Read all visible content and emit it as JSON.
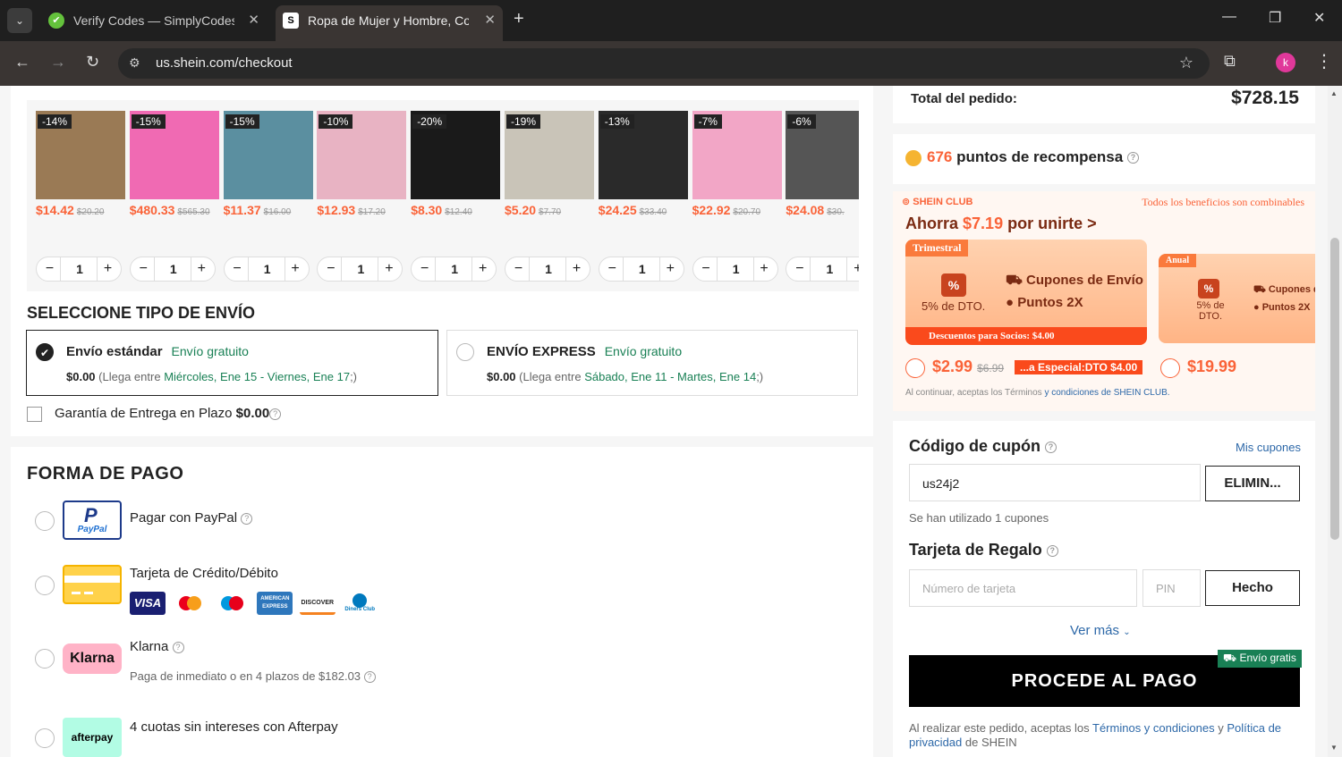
{
  "browser": {
    "tabs": [
      {
        "title": "Verify Codes — SimplyCodes",
        "favicon": "✔"
      },
      {
        "title": "Ropa de Mujer y Hombre, Comp",
        "favicon": "S"
      }
    ],
    "url": "us.shein.com/checkout",
    "profile_initial": "k"
  },
  "products": [
    {
      "discount": "-14%",
      "price": "$14.42",
      "old_price": "$20.20",
      "qty": "1",
      "color": "#9a7a55"
    },
    {
      "discount": "-15%",
      "price": "$480.33",
      "old_price": "$565.30",
      "qty": "1",
      "color": "#f06ab3"
    },
    {
      "discount": "-15%",
      "price": "$11.37",
      "old_price": "$16.00",
      "qty": "1",
      "color": "#5b8fa0"
    },
    {
      "discount": "-10%",
      "price": "$12.93",
      "old_price": "$17.20",
      "qty": "1",
      "color": "#e8b3c3"
    },
    {
      "discount": "-20%",
      "price": "$8.30",
      "old_price": "$12.40",
      "qty": "1",
      "color": "#1a1a1a"
    },
    {
      "discount": "-19%",
      "price": "$5.20",
      "old_price": "$7.70",
      "qty": "1",
      "color": "#c9c4b8"
    },
    {
      "discount": "-13%",
      "price": "$24.25",
      "old_price": "$33.40",
      "qty": "1",
      "color": "#2a2a2a"
    },
    {
      "discount": "-7%",
      "price": "$22.92",
      "old_price": "$20.70",
      "qty": "1",
      "color": "#f2a6c6"
    },
    {
      "discount": "-6%",
      "price": "$24.08",
      "old_price": "$30.",
      "qty": "1",
      "color": "#555555"
    }
  ],
  "shipping": {
    "title": "SELECCIONE TIPO DE ENVÍO",
    "options": [
      {
        "name": "Envío estándar",
        "free": "Envío gratuito",
        "cost": "$0.00",
        "detail_prefix": "(Llega entre",
        "dates": "Miércoles, Ene 15 - Viernes, Ene 17",
        "detail_suffix": ";)",
        "selected": true
      },
      {
        "name": "ENVÍO EXPRESS",
        "free": "Envío gratuito",
        "cost": "$0.00",
        "detail_prefix": "(Llega entre",
        "dates": "Sábado, Ene 11 - Martes, Ene 14",
        "detail_suffix": ";)",
        "selected": false
      }
    ],
    "guarantee_label": "Garantía de Entrega en Plazo",
    "guarantee_price": "$0.00"
  },
  "payment": {
    "title": "FORMA DE PAGO",
    "paypal": "Pagar con PayPal",
    "paypal_logo": "PayPal",
    "card": "Tarjeta de Crédito/Débito",
    "card_brands": [
      "VISA",
      "mastercard",
      "maestro",
      "AMERICAN EXPRESS",
      "DISCOVER",
      "Diners Club"
    ],
    "klarna": "Klarna",
    "klarna_logo": "Klarna",
    "klarna_sub": "Paga de inmediato o en 4 plazos de $182.03",
    "afterpay": "4 cuotas sin intereses con Afterpay",
    "afterpay_logo": "afterpay"
  },
  "summary": {
    "total_label": "Total del pedido:",
    "total_value": "$728.15",
    "points_num": "676",
    "points_label": "puntos de recompensa"
  },
  "club": {
    "brand": "SHEIN CLUB",
    "combinable": "Todos los beneficios son combinables",
    "save_prefix": "Ahorra",
    "save_amount": "$7.19",
    "save_suffix": "por unirte >",
    "plan1": {
      "tag": "Trimestral",
      "dto": "5% de DTO.",
      "benefit1": "Cupones de Envío",
      "benefit2": "Puntos 2X",
      "bar": "Descuentos para Socios: $4.00",
      "price": "$2.99",
      "old_price": "$6.99"
    },
    "plan2": {
      "tag": "Anual",
      "dto": "5% de DTO.",
      "benefit1": "Cupones de",
      "benefit2": "Puntos 2X",
      "price": "$19.99"
    },
    "special": "...a Especial:DTO $4.00",
    "terms_prefix": "Al continuar, aceptas los Términos",
    "terms_link": "y condiciones de SHEIN CLUB."
  },
  "coupon": {
    "title": "Código de cupón",
    "my_coupons": "Mis cupones",
    "value": "us24j2",
    "remove_button": "ELIMIN...",
    "used": "Se han utilizado 1 cupones"
  },
  "gift": {
    "title": "Tarjeta de Regalo",
    "card_placeholder": "Número de tarjeta",
    "pin_placeholder": "PIN",
    "done_button": "Hecho",
    "more": "Ver más"
  },
  "checkout": {
    "button": "PROCEDE AL PAGO",
    "free_badge": "Envío gratis",
    "legal_prefix": "Al realizar este pedido, aceptas los",
    "legal_terms": "Términos y condiciones",
    "legal_and": "y",
    "legal_privacy": "Política de privacidad",
    "legal_suffix": "de SHEIN"
  }
}
